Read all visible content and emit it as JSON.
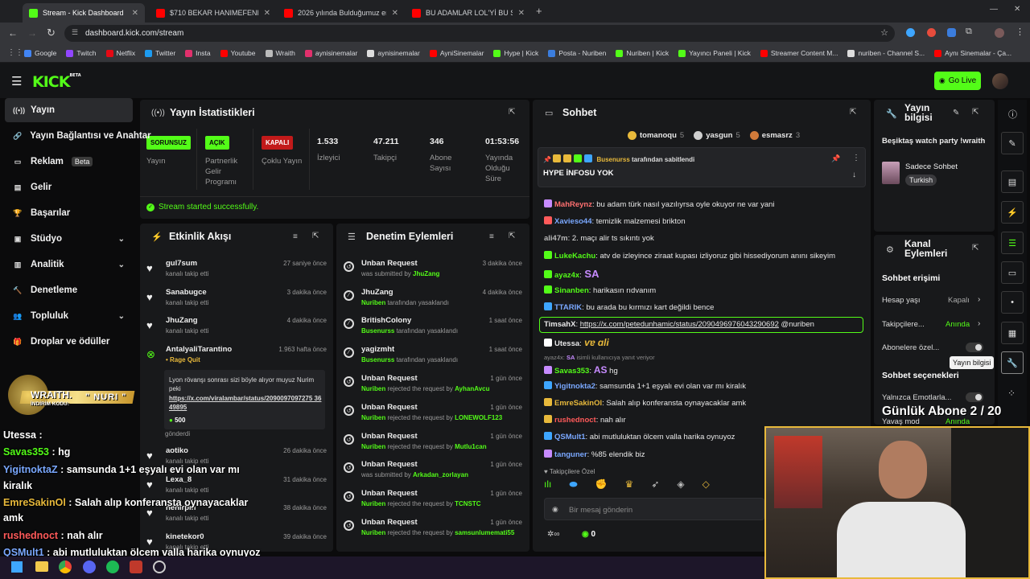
{
  "browser": {
    "tabs": [
      {
        "title": "Stream - Kick Dashboard",
        "icon": "kick-icon",
        "color": "#53fc18"
      },
      {
        "title": "$710 BEKAR HANIMEFENDİNİN",
        "icon": "youtube-icon",
        "color": "#ff0000"
      },
      {
        "title": "2026 yılında Bulduğumuz en iyi",
        "icon": "youtube-icon",
        "color": "#ff0000"
      },
      {
        "title": "BU ADAMLAR LOL'Yİ BU SEFER",
        "icon": "youtube-icon",
        "color": "#ff0000"
      }
    ],
    "url": "dashboard.kick.com/stream",
    "bookmarks": [
      {
        "label": "Google",
        "color": "#4285f4"
      },
      {
        "label": "Twitch",
        "color": "#9146ff"
      },
      {
        "label": "Netflix",
        "color": "#e50914"
      },
      {
        "label": "Twitter",
        "color": "#1d9bf0"
      },
      {
        "label": "Insta",
        "color": "#e1306c"
      },
      {
        "label": "Youtube",
        "color": "#ff0000"
      },
      {
        "label": "Wraith",
        "color": "#bbbbbb"
      },
      {
        "label": "aynisinemalar",
        "color": "#e1306c"
      },
      {
        "label": "aynisinemalar",
        "color": "#dddddd"
      },
      {
        "label": "AyniSinemalar",
        "color": "#ff0000"
      },
      {
        "label": "Hype | Kick",
        "color": "#53fc18"
      },
      {
        "label": "Posta - Nuriben",
        "color": "#3b7ddd"
      },
      {
        "label": "Nuriben | Kick",
        "color": "#53fc18"
      },
      {
        "label": "Yayıncı Paneli | Kick",
        "color": "#53fc18"
      },
      {
        "label": "Streamer Content M...",
        "color": "#ff0000"
      },
      {
        "label": "nuriben - Channel S...",
        "color": "#dddddd"
      },
      {
        "label": "Aynı Sinemalar - Ça...",
        "color": "#ff0000"
      }
    ]
  },
  "kick": {
    "logo": "KICK",
    "logo_sup": "BETA",
    "go_live": "Go Live"
  },
  "sidebar": {
    "items": [
      {
        "label": "Yayın",
        "icon": "broadcast-icon"
      },
      {
        "label": "Yayın Bağlantısı ve Anahtar",
        "icon": "link-icon"
      },
      {
        "label": "Reklam",
        "icon": "ad-icon",
        "badge": "Beta"
      },
      {
        "label": "Gelir",
        "icon": "revenue-icon"
      },
      {
        "label": "Başarılar",
        "icon": "trophy-icon"
      },
      {
        "label": "Stüdyo",
        "icon": "studio-icon"
      },
      {
        "label": "Analitik",
        "icon": "analytics-icon"
      },
      {
        "label": "Denetleme",
        "icon": "hammer-icon"
      },
      {
        "label": "Topluluk",
        "icon": "community-icon"
      },
      {
        "label": "Droplar ve ödüller",
        "icon": "drops-icon"
      }
    ]
  },
  "stats": {
    "title": "Yayın İstatistikleri",
    "badges": [
      {
        "text": "SORUNSUZ",
        "bg": "#53fc18",
        "fg": "#0b0b0c",
        "label": "Yayın"
      },
      {
        "text": "AÇIK",
        "bg": "#53fc18",
        "fg": "#0b0b0c",
        "label": "Partnerlik Gelir Programı"
      },
      {
        "text": "KAPALI",
        "bg": "#c21a1a",
        "fg": "#ffffff",
        "label": "Çoklu Yayın"
      }
    ],
    "values": [
      {
        "value": "1.533",
        "label": "İzleyici"
      },
      {
        "value": "47.211",
        "label": "Takipçi"
      },
      {
        "value": "346",
        "label": "Abone Sayısı"
      },
      {
        "value": "01:53:56",
        "label": "Yayında Olduğu Süre"
      }
    ],
    "status": "Stream started successfully."
  },
  "activity": {
    "title": "Etkinlik Akışı",
    "items": [
      {
        "name": "gul7sum",
        "sub": "kanalı takip etti",
        "time": "27 saniye önce"
      },
      {
        "name": "Sanabugce",
        "sub": "kanalı takip etti",
        "time": "3 dakika önce"
      },
      {
        "name": "JhuZang",
        "sub": "kanalı takip etti",
        "time": "4 dakika önce"
      },
      {
        "name": "AntalyaliTarantino",
        "sub": "Rage Quit",
        "time": "1.963 hafta önce"
      },
      {
        "name": "aotiko",
        "sub": "kanalı takip etti",
        "time": "26 dakika önce"
      },
      {
        "name": "Lexa_8",
        "sub": "kanalı takip etti",
        "time": "31 dakika önce"
      },
      {
        "name": "nehirpin",
        "sub": "kanalı takip etti",
        "time": "38 dakika önce"
      },
      {
        "name": "kinetekor0",
        "sub": "kanalı takip etti",
        "time": "39 dakika önce"
      }
    ],
    "quote": "Lyon rövanşı sonrası sizi böyle alıyor muyuz Nurim peki",
    "quote_link": "https://x.com/viralambar/status/2090097097275 3649895",
    "quote_amount": "500",
    "quote_footer": "gönderdi"
  },
  "moderation": {
    "title": "Denetim Eylemleri",
    "items": [
      {
        "name": "Unban Request",
        "pre": "was submitted by ",
        "user": "JhuZang",
        "post": "",
        "time": "3 dakika önce",
        "icon": "unban-icon"
      },
      {
        "name": "JhuZang",
        "pre": "",
        "user": "Nuriben",
        "post": " tarafından yasaklandı",
        "time": "4 dakika önce",
        "icon": "ban-icon"
      },
      {
        "name": "BritishColony",
        "pre": "",
        "user": "Busenurss",
        "post": " tarafından yasaklandı",
        "time": "1 saat önce",
        "icon": "ban-icon"
      },
      {
        "name": "yagizmht",
        "pre": "",
        "user": "Busenurss",
        "post": " tarafından yasaklandı",
        "time": "1 saat önce",
        "icon": "ban-icon"
      },
      {
        "name": "Unban Request",
        "pre": "",
        "user": "Nuriben",
        "post": " rejected the request by ",
        "user2": "AyhanAvcu",
        "time": "1 gün önce",
        "icon": "unban-icon"
      },
      {
        "name": "Unban Request",
        "pre": "",
        "user": "Nuriben",
        "post": " rejected the request by ",
        "user2": "LONEWOLF123",
        "time": "1 gün önce",
        "icon": "unban-icon"
      },
      {
        "name": "Unban Request",
        "pre": "",
        "user": "Nuriben",
        "post": " rejected the request by ",
        "user2": "Mutlu1can",
        "time": "1 gün önce",
        "icon": "unban-icon"
      },
      {
        "name": "Unban Request",
        "pre": "was submitted by ",
        "user": "Arkadan_zorlayan",
        "post": "",
        "time": "1 gün önce",
        "icon": "unban-icon"
      },
      {
        "name": "Unban Request",
        "pre": "",
        "user": "Nuriben",
        "post": " rejected the request by ",
        "user2": "TCNSTC",
        "time": "1 gün önce",
        "icon": "unban-icon"
      },
      {
        "name": "Unban Request",
        "pre": "",
        "user": "Nuriben",
        "post": " rejected the request by ",
        "user2": "samsunlumemati55",
        "time": "1 gün önce",
        "icon": "unban-icon"
      }
    ]
  },
  "chat": {
    "title": "Sohbet",
    "top_gifters": [
      {
        "name": "tomanoqu",
        "count": "5",
        "color": "#e8b93b"
      },
      {
        "name": "yasgun",
        "count": "5",
        "color": "#cfcfcf"
      },
      {
        "name": "esmasrz",
        "count": "3",
        "color": "#d07a3a"
      }
    ],
    "pinned_by": "Busenurss",
    "pinned_suffix": " tarafından sabitlendi",
    "pinned_text": "HYPE İNFOSU YOK",
    "messages": [
      {
        "user": "MahReynz",
        "color": "#ff7070",
        "text": ": bu adam türk nasıl yazılıyrsa oyle okuyor ne var yani"
      },
      {
        "user": "Xavieso44",
        "color": "#7aa8ff",
        "text": ": temizlik malzemesi brikton"
      },
      {
        "user": "ali47m",
        "color": "#b8b8b8",
        "text": ": 2. maçı alir ts sıkıntı yok"
      },
      {
        "user": "LukeKachu",
        "color": "#53fc18",
        "text": ": atv de izleyince ziraat kupası izliyoruz gibi hissediyorum anını sikeyim"
      },
      {
        "user": "ayaz4x",
        "color": "#53fc18",
        "text": ":"
      },
      {
        "user": "Sinanben",
        "color": "#53fc18",
        "text": ": harikasın rıdvanım"
      },
      {
        "user": "TTARIK",
        "color": "#7aa8ff",
        "text": ": bu arada bu kırmızı kart değildi bence"
      },
      {
        "user": "TimsahX",
        "color": "#e8e8e8",
        "text": ": ",
        "link": "https://x.com/petedunhamic/status/2090496976043290692",
        "after": " @nuriben"
      },
      {
        "user": "Utessa",
        "color": "#e8e8e8",
        "text": ":"
      },
      {
        "user": "Savas353",
        "color": "#53fc18",
        "text": ":",
        "after": " hg"
      },
      {
        "user": "Yigitnokta2",
        "color": "#7aa8ff",
        "text": ": samsunda 1+1 eşyalı evi olan var mı kiralık"
      },
      {
        "user": "EmreSakinOl",
        "color": "#e8b93b",
        "text": ": Salah alıp konferansta oynayacaklar amk"
      },
      {
        "user": "rushednoct",
        "color": "#ff5a5a",
        "text": ": nah alır"
      },
      {
        "user": "QSMult1",
        "color": "#7aa8ff",
        "text": ": abi mutluluktan ölcem valla harika oynuyoz"
      },
      {
        "user": "tanguner",
        "color": "#7aa8ff",
        "text": ": %85 elendik biz"
      }
    ],
    "reply_note": "isimli kullanıcıya yanıt veriyor",
    "reply_user": "ayaz4x:",
    "followers_only": "Takipçilere Özel",
    "input_placeholder": "Bir mesaj gönderin",
    "points": "0"
  },
  "stream_info": {
    "title": "Yayın bilgisi",
    "stream_title": "Beşiktaş watch party !wraith",
    "category": "Sadece Sohbet",
    "tag": "Turkish"
  },
  "channel_actions": {
    "title": "Kanal Eylemleri",
    "access_title": "Sohbet erişimi",
    "rows": [
      {
        "label": "Hesap yaşı",
        "value": "Kapalı"
      },
      {
        "label": "Takipçilere...",
        "value": "Anında"
      },
      {
        "label": "Abonelere özel...",
        "value": ""
      }
    ],
    "options_title": "Sohbet seçenekleri",
    "option_rows": [
      {
        "label": "Yalnızca Emotlarla...",
        "value": ""
      },
      {
        "label": "Yavaş mod",
        "value": "Anında"
      }
    ],
    "tooltip": "Yayın bilgisi"
  },
  "overlay": {
    "sub_goal": "Günlük Abone 2 / 20",
    "wraith_title": "WRAITH.",
    "wraith_code_label": "İNDİRİM KODU:",
    "wraith_code": "NURI",
    "messages": [
      {
        "user": "Utessa",
        "color": "#ffffff",
        "text": " :"
      },
      {
        "user": "Savas353",
        "color": "#53fc18",
        "text": " :  hg"
      },
      {
        "user": "YigitnoktaZ",
        "color": "#7aa8ff",
        "text": " : samsunda 1+1 eşyalı evi olan var mı"
      },
      {
        "user": "",
        "color": "#ffffff",
        "text": "kiralık"
      },
      {
        "user": "EmreSakinOl",
        "color": "#e8b93b",
        "text": " : Salah alıp konferansta oynayacaklar"
      },
      {
        "user": "",
        "color": "#ffffff",
        "text": "amk"
      },
      {
        "user": "rushednoct",
        "color": "#ff5a5a",
        "text": " : nah alır"
      },
      {
        "user": "QSMult1",
        "color": "#7aa8ff",
        "text": " : abi mutluluktan ölcem valla harika oynuyoz"
      }
    ]
  }
}
